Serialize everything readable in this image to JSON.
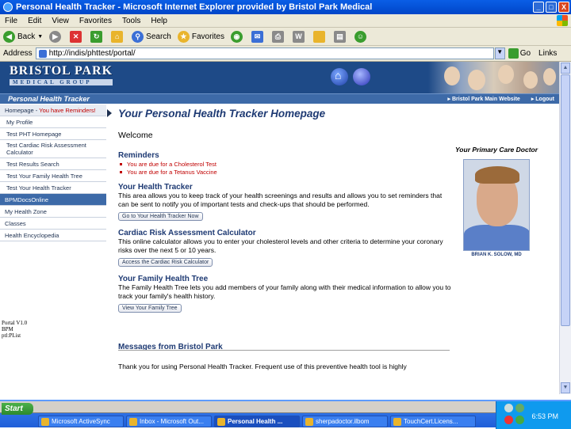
{
  "window": {
    "title": "Personal Health Tracker - Microsoft Internet Explorer provided by Bristol Park Medical",
    "buttons": [
      "_",
      "□",
      "X"
    ]
  },
  "menu": [
    "File",
    "Edit",
    "View",
    "Favorites",
    "Tools",
    "Help"
  ],
  "toolbar": {
    "back": "Back",
    "search": "Search",
    "favorites": "Favorites"
  },
  "address": {
    "label": "Address",
    "url": "http://indis/phttest/portal/",
    "go": "Go",
    "links": "Links"
  },
  "banner": {
    "logo_line1": "BRISTOL PARK",
    "logo_line2": "MEDICAL GROUP",
    "section": "Personal Health Tracker",
    "link_main": "Bristol Park Main Website",
    "link_logout": "Logout"
  },
  "nav": {
    "homepage": "Homepage - ",
    "reminders": "You have Reminders!",
    "items": [
      "My Profile",
      "Test PHT Homepage",
      "Test Cardiac Risk Assessment Calculator",
      "Test Results Search",
      "Test Your Family Health Tree",
      "Test Your Health Tracker"
    ],
    "selected": "BPMDocsOnline",
    "bottom": [
      "My Health Zone",
      "Classes",
      "Health Encyclopedia"
    ],
    "page_code": [
      "Portal V1.0",
      "BPM",
      "",
      "ptl:PList"
    ]
  },
  "content": {
    "title": "Your Personal Health Tracker Homepage",
    "welcome": "Welcome",
    "reminders_title": "Reminders",
    "reminders": [
      "You are due for a Cholesterol Test",
      "You are due for a Tetanus Vaccine"
    ],
    "tracker_title": "Your Health Tracker",
    "tracker_body": "This area allows you to keep track of your health screenings and results and allows you to set reminders that can be sent to notify you of important tests and check-ups that should be performed.",
    "tracker_btn": "Go to Your Health Tracker Now",
    "cardiac_title": "Cardiac Risk Assessment Calculator",
    "cardiac_body": "This online calculator allows you to enter your cholesterol levels and other criteria to determine your coronary risks over the next 5 or 10 years.",
    "cardiac_btn": "Access the Cardiac Risk Calculator",
    "family_title": "Your Family Health Tree",
    "family_body": "The Family Health Tree lets you add members of your family along with their medical information to allow you to track your family's health history.",
    "family_btn": "View Your Family Tree",
    "messages_title": "Messages from Bristol Park",
    "messages_body": "Thank you for using Personal Health Tracker. Frequent use of this preventive health tool is highly"
  },
  "doctor": {
    "label": "Your Primary Care Doctor",
    "name": "BRIAN K. SOLOW, MD"
  },
  "taskbar": {
    "start": "Start",
    "tasks": [
      "Microsoft ActiveSync",
      "Inbox - Microsoft Out...",
      "Personal Health ...",
      "sherpadoctor.ilbom",
      "TouchCert.Licens..."
    ],
    "time": "6:53 PM"
  },
  "colors": {
    "navy": "#1e4a87",
    "nav_blue": "#3d6aa8",
    "reminder_red": "#c00000",
    "title_blue": "#1e3a73"
  }
}
